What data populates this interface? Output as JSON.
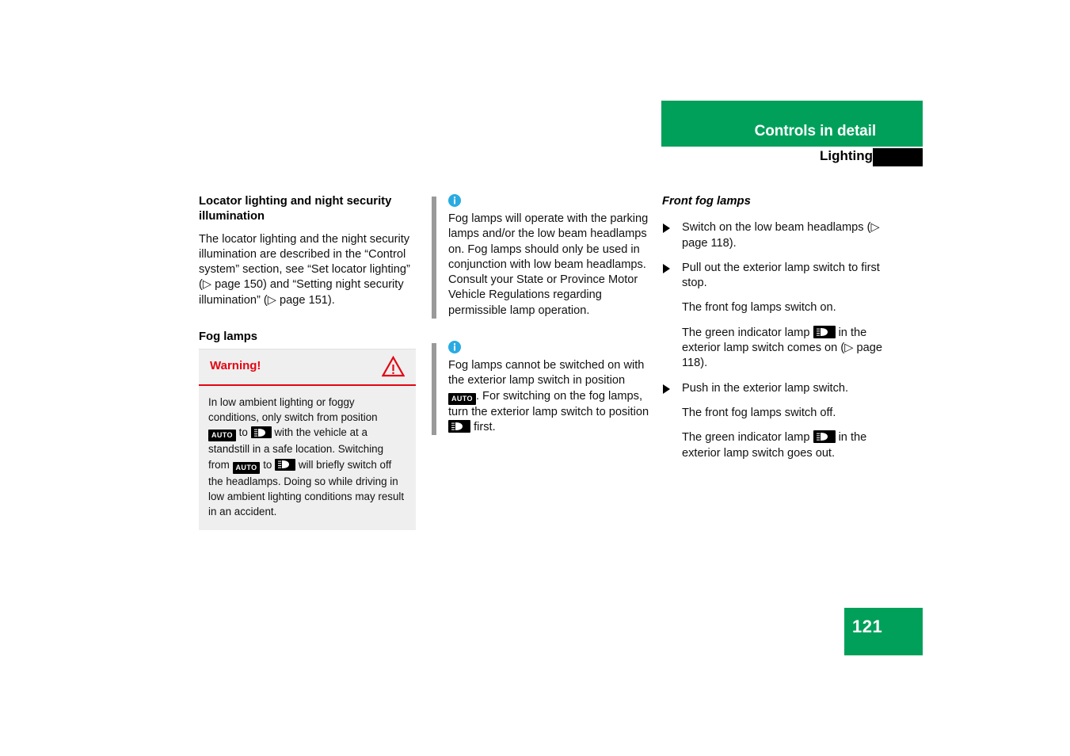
{
  "header": {
    "title": "Controls in detail",
    "subtitle": "Lighting",
    "green_hex": "#00a05a",
    "tab_hex": "#000000"
  },
  "left_column": {
    "heading": "Locator lighting and night security illumination",
    "paragraph": "The locator lighting and the night security illumination are described in the “Control system” section, see “Set locator lighting” (▷ page 150) and “Setting night security illumination” (▷ page 151).",
    "subheading": "Fog lamps",
    "warning": {
      "title": "Warning!",
      "icon": "warning-triangle-icon",
      "accent_hex": "#e30613",
      "background_hex": "#efefef",
      "text_part1": "In low ambient lighting or foggy conditions, only switch from position",
      "badge1": "AUTO",
      "text_part2": "to",
      "badge2": "low-beam-headlamp-symbol",
      "text_part3": "with the vehicle at a standstill in a safe location. Switching from",
      "badge3": "AUTO",
      "text_part4": "to",
      "badge4": "low-beam-headlamp-symbol",
      "text_part5": "will briefly switch off the headlamps. Doing so while driving in low ambient lighting conditions may result in an accident."
    }
  },
  "middle_column": {
    "notes": [
      {
        "icon": "info-icon",
        "text": "Fog lamps will operate with the parking lamps and/or the low beam headlamps on. Fog lamps should only be used in conjunction with low beam headlamps. Consult your State or Province Motor Vehicle Regulations regarding permissible lamp operation."
      },
      {
        "icon": "info-icon",
        "text_part1": "Fog lamps cannot be switched on with the exterior lamp switch in position",
        "badge1": "AUTO",
        "text_part2": ". For switching on the fog lamps, turn the exterior lamp switch to position",
        "badge2": "low-beam-headlamp-symbol",
        "text_part3": "first."
      }
    ],
    "info_icon_hex": "#29abe2",
    "bar_hex": "#9a9a9a"
  },
  "right_column": {
    "heading": "Front fog lamps",
    "steps": [
      {
        "marker": "▶",
        "text": "Switch on the low beam headlamps (▷ page 118)."
      },
      {
        "marker": "▶",
        "text": "Pull out the exterior lamp switch to first stop."
      }
    ],
    "result1": "The front fog lamps switch on.",
    "indicator_on": {
      "text_part1": "The green indicator lamp",
      "badge": "fog-lamp-indicator-symbol",
      "text_part2": "in the exterior lamp switch comes on (▷ page 118)."
    },
    "step3": {
      "marker": "▶",
      "text": "Push in the exterior lamp switch."
    },
    "result2": "The front fog lamps switch off.",
    "indicator_off": {
      "text_part1": "The green indicator lamp",
      "badge": "fog-lamp-indicator-symbol",
      "text_part2": "in the exterior lamp switch goes out."
    }
  },
  "footer": {
    "page_number": "121",
    "green_hex": "#00a05a"
  }
}
